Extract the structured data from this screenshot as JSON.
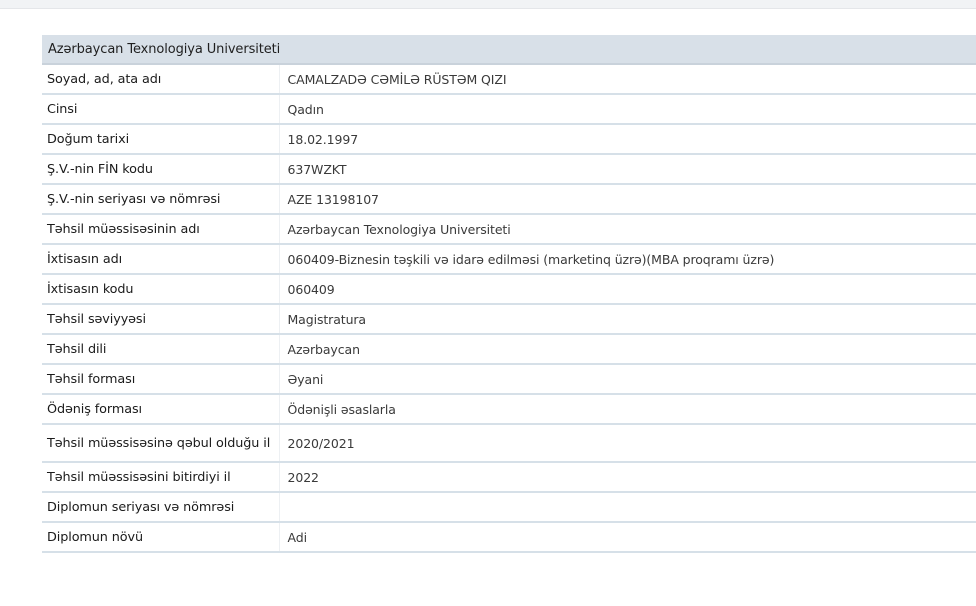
{
  "header": {
    "title": "Azərbaycan Texnologiya Universiteti"
  },
  "rows": [
    {
      "label": "Soyad, ad, ata adı",
      "value": "CAMALZADƏ CƏMİLƏ RÜSTƏM QIZI"
    },
    {
      "label": "Cinsi",
      "value": "Qadın"
    },
    {
      "label": "Doğum tarixi",
      "value": "18.02.1997"
    },
    {
      "label": "Ş.V.-nin FİN kodu",
      "value": "637WZKT"
    },
    {
      "label": "Ş.V.-nin seriyası və nömrəsi",
      "value": "AZE 13198107"
    },
    {
      "label": "Təhsil müəssisəsinin adı",
      "value": "Azərbaycan Texnologiya Universiteti"
    },
    {
      "label": "İxtisasın adı",
      "value": "060409-Biznesin təşkili və idarə edilməsi (marketinq üzrə)(MBA proqramı üzrə)"
    },
    {
      "label": "İxtisasın kodu",
      "value": "060409"
    },
    {
      "label": "Təhsil səviyyəsi",
      "value": "Magistratura"
    },
    {
      "label": "Təhsil dili",
      "value": "Azərbaycan"
    },
    {
      "label": "Təhsil forması",
      "value": "Əyani"
    },
    {
      "label": "Ödəniş forması",
      "value": "Ödənişli əsaslarla"
    },
    {
      "label": "Təhsil müəssisəsinə qəbul olduğu il",
      "value": "2020/2021"
    },
    {
      "label": "Təhsil müəssisəsini bitirdiyi il",
      "value": "2022"
    },
    {
      "label": "Diplomun seriyası və nömrəsi",
      "value": ""
    },
    {
      "label": "Diplomun növü",
      "value": "Adi"
    }
  ]
}
